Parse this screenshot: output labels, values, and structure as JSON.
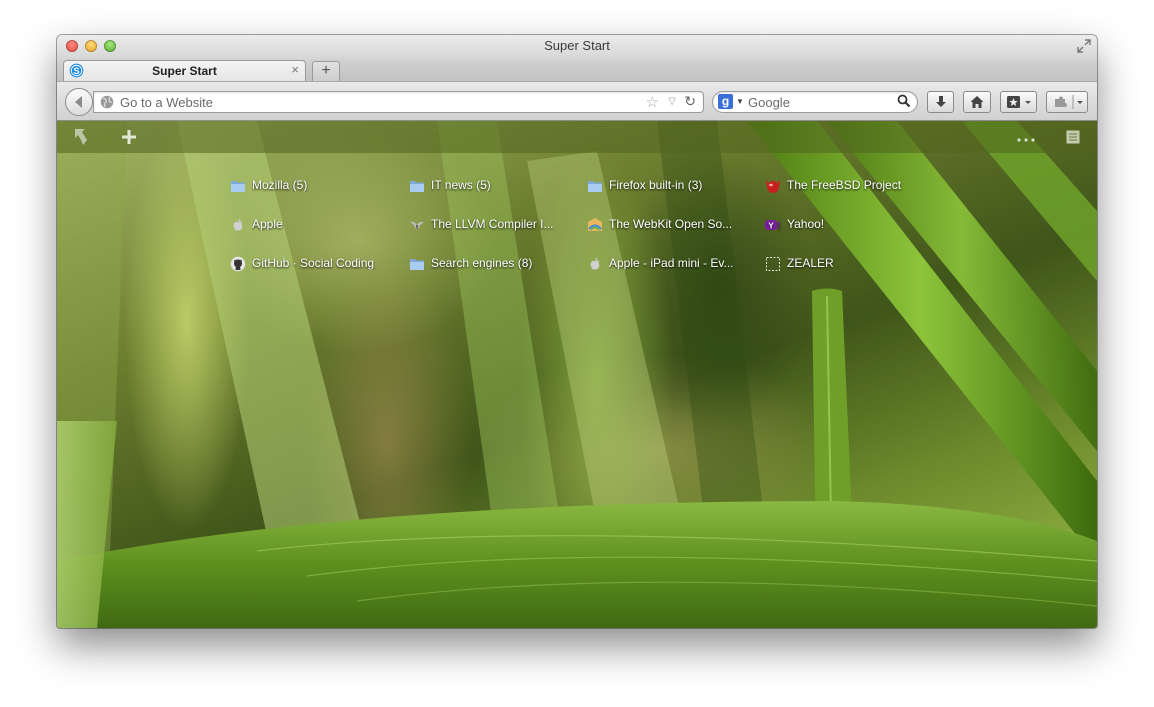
{
  "window": {
    "title": "Super Start"
  },
  "tab": {
    "label": "Super Start",
    "close_glyph": "×"
  },
  "newtab": {
    "glyph": "+"
  },
  "urlbar": {
    "placeholder": "Go to a Website"
  },
  "searchbar": {
    "placeholder": "Google",
    "engine_letter": "g"
  },
  "icons": {
    "globe": "globe-icon",
    "bookmark_star": "star-icon",
    "reload": "reload-icon",
    "download": "download-icon",
    "home": "home-icon",
    "bookmarks": "bookmarks-icon",
    "addon": "puzzle-icon"
  },
  "content_toolbar": {
    "left": [
      "undo-arrow-icon",
      "add-plus-icon"
    ],
    "right": [
      "more-dots-icon",
      "notes-list-icon"
    ]
  },
  "sites": [
    {
      "label": "Mozilla (5)",
      "icon": "folder"
    },
    {
      "label": "IT news (5)",
      "icon": "folder"
    },
    {
      "label": "Firefox built-in (3)",
      "icon": "folder"
    },
    {
      "label": "The FreeBSD Project",
      "icon": "freebsd"
    },
    {
      "label": "Apple",
      "icon": "apple"
    },
    {
      "label": "The LLVM Compiler I...",
      "icon": "llvm"
    },
    {
      "label": "The WebKit Open So...",
      "icon": "webkit"
    },
    {
      "label": "Yahoo!",
      "icon": "yahoo"
    },
    {
      "label": "GitHub · Social Coding",
      "icon": "github"
    },
    {
      "label": "Search engines (8)",
      "icon": "folder"
    },
    {
      "label": "Apple - iPad mini - Ev...",
      "icon": "apple"
    },
    {
      "label": "ZEALER",
      "icon": "blank"
    }
  ],
  "colors": {
    "folder": "#8fb8e6",
    "freebsd": "#c8201f",
    "yahoo": "#7b1fa2",
    "search_engine": "#3a6fd8"
  }
}
